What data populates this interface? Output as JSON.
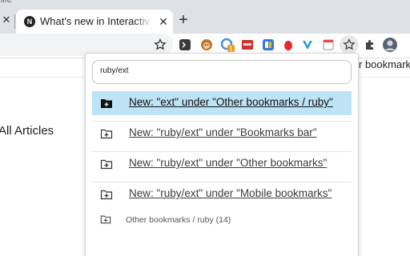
{
  "window": {
    "title_fragment": "hife"
  },
  "tabs": [
    {
      "title": "What's new in Interactive",
      "favicon_letter": "N",
      "active": true
    }
  ],
  "page": {
    "heading": "All Articles",
    "right_text": "r bookmark"
  },
  "toolbar": {
    "icons": [
      "bookmark-star-icon",
      "extension-terminal-icon",
      "extension-monkey-icon",
      "extension-badge-icon",
      "extension-red-square-icon",
      "extension-blue-square-icon",
      "extension-red-drop-icon",
      "extension-v-icon",
      "extension-calendar-icon",
      "extension-active-star-icon",
      "extensions-puzzle-icon",
      "profile-avatar-icon"
    ],
    "badge_count": "1"
  },
  "popup": {
    "search": {
      "value": "ruby/ext",
      "placeholder": ""
    },
    "suggestions": [
      {
        "label": "New: \"ext\" under \"Other bookmarks / ruby\"",
        "selected": true
      },
      {
        "label": "New: \"ruby/ext\" under \"Bookmarks bar\"",
        "selected": false
      },
      {
        "label": "New: \"ruby/ext\" under \"Other bookmarks\"",
        "selected": false
      },
      {
        "label": "New: \"ruby/ext\" under \"Mobile bookmarks\"",
        "selected": false
      }
    ],
    "folder_item": {
      "label": "Other bookmarks / ruby (14)"
    }
  },
  "colors": {
    "selected_bg": "#bde3f5",
    "tabstrip_bg": "#dee1e6"
  }
}
